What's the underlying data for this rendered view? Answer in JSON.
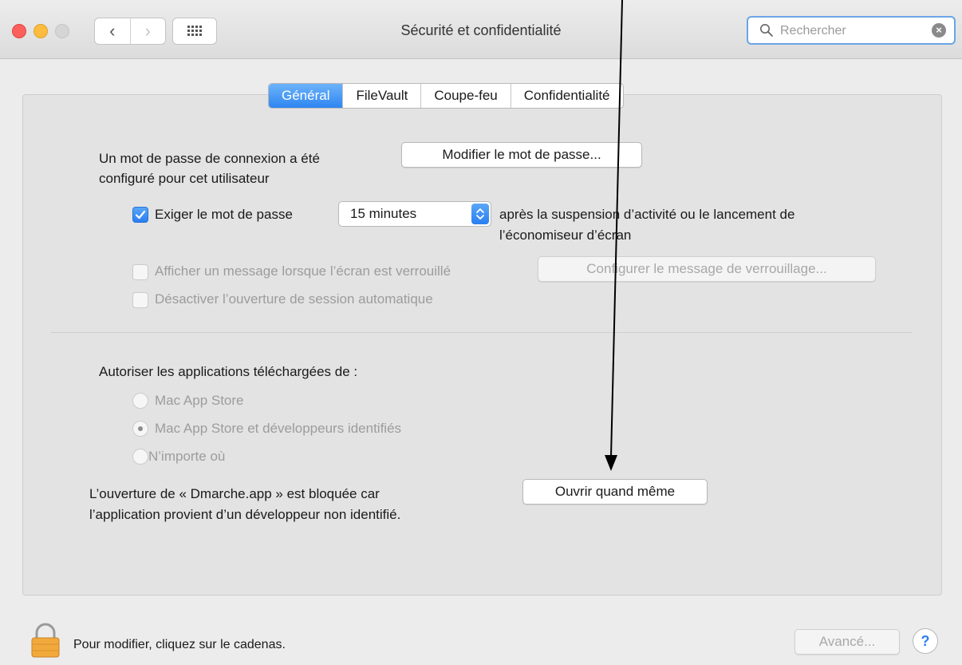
{
  "window": {
    "title": "Sécurité et confidentialité",
    "search_placeholder": "Rechercher"
  },
  "tabs": [
    {
      "label": "Général",
      "active": true
    },
    {
      "label": "FileVault",
      "active": false
    },
    {
      "label": "Coupe-feu",
      "active": false
    },
    {
      "label": "Confidentialité",
      "active": false
    }
  ],
  "general": {
    "password_text_line1": "Un mot de passe de connexion a été",
    "password_text_line2": "configuré pour cet utilisateur",
    "change_password_button": "Modifier le mot de passe...",
    "require_password_label": "Exiger le mot de passe",
    "require_password_checked": true,
    "require_password_delay": "15 minutes",
    "after_text_line1": "après la suspension d’activité ou le lancement de",
    "after_text_line2": "l’économiseur d’écran",
    "show_message_label": "Afficher un message lorsque l’écran est verrouillé",
    "show_message_checked": false,
    "set_lock_message_button": "Configurer le message de verrouillage...",
    "disable_auto_login_label": "Désactiver l’ouverture de session automatique",
    "disable_auto_login_checked": false,
    "allow_apps_heading": "Autoriser les applications téléchargées de :",
    "allow_options": [
      {
        "label": "Mac App Store",
        "selected": false
      },
      {
        "label": "Mac App Store et développeurs identifiés",
        "selected": true
      },
      {
        "label": "N’importe où",
        "selected": false
      }
    ],
    "blocked_text_line1": "L’ouverture de « Dmarche.app » est bloquée car",
    "blocked_text_line2": "l’application provient d’un développeur non identifié.",
    "open_anyway_button": "Ouvrir quand même"
  },
  "footer": {
    "lock_text": "Pour modifier, cliquez sur le cadenas.",
    "advanced_button": "Avancé...",
    "help_button": "?"
  },
  "colors": {
    "accent": "#2f86f1",
    "window_bg": "#ececec",
    "panel_bg": "#e3e3e3"
  }
}
